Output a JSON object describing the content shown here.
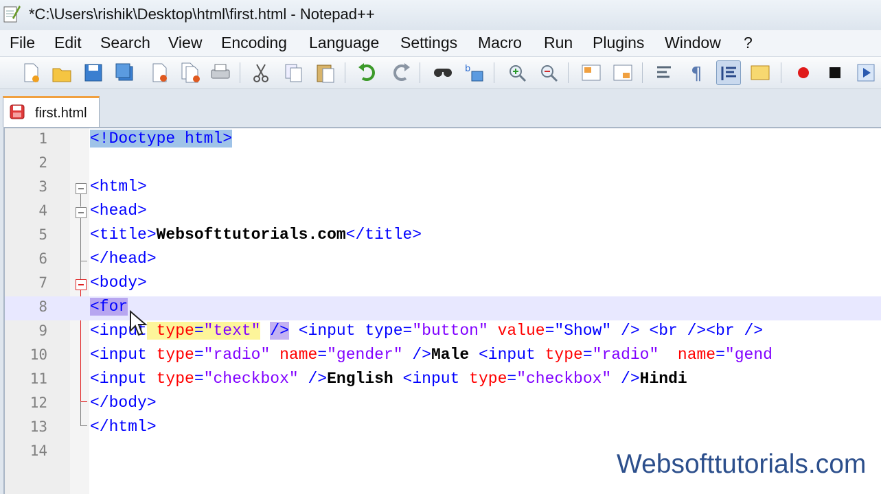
{
  "window": {
    "title": "*C:\\Users\\rishik\\Desktop\\html\\first.html - Notepad++"
  },
  "menu": [
    "File",
    "Edit",
    "Search",
    "View",
    "Encoding",
    "Language",
    "Settings",
    "Macro",
    "Run",
    "Plugins",
    "Window",
    "?"
  ],
  "tab": {
    "label": "first.html"
  },
  "editor": {
    "line_numbers": [
      "1",
      "2",
      "3",
      "4",
      "5",
      "6",
      "7",
      "8",
      "9",
      "10",
      "11",
      "12",
      "13",
      "14"
    ],
    "lines": {
      "l1": [
        "<!Doctype html>"
      ],
      "l3": [
        "<html>"
      ],
      "l4": [
        "<head>"
      ],
      "l5": [
        "<title>",
        "Websofttutorials.com",
        "</title>"
      ],
      "l6": [
        "</head>"
      ],
      "l7": [
        "<body>"
      ],
      "l8": [
        "<for"
      ],
      "l9": [
        "<input",
        " type",
        "=",
        "\"text\"",
        "/>",
        " <input type=",
        "\"button\"",
        "value",
        "=\"Show\" /> <br /><br />"
      ],
      "l10": [
        "<input ",
        "type",
        "=",
        "\"radio\"",
        "name",
        "=",
        "\"gender\"",
        "/>",
        "Male",
        "<input ",
        "type",
        "=",
        "\"radio\"",
        "name",
        "=",
        "\"gend"
      ],
      "l11": [
        "<input ",
        "type",
        "=",
        "\"checkbox\"",
        "/>",
        "English",
        "<input ",
        "type",
        "=",
        "\"checkbox\"",
        "/>",
        "Hindi"
      ],
      "l12": [
        "</body>"
      ],
      "l13": [
        "</html>"
      ]
    }
  },
  "watermark": "Websofttutorials.com"
}
